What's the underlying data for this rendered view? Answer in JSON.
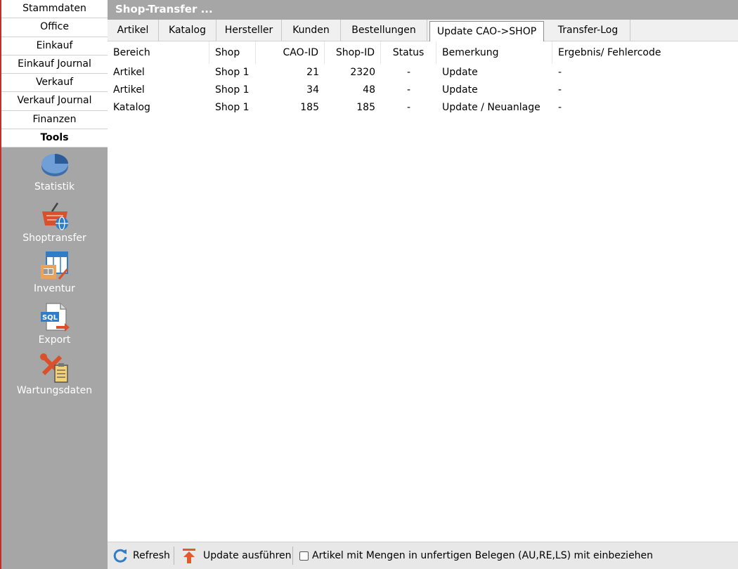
{
  "sidebar": {
    "nav_items": [
      {
        "label": "Stammdaten"
      },
      {
        "label": "Office"
      },
      {
        "label": "Einkauf"
      },
      {
        "label": "Einkauf Journal"
      },
      {
        "label": "Verkauf"
      },
      {
        "label": "Verkauf Journal"
      },
      {
        "label": "Finanzen"
      },
      {
        "label": "Tools"
      }
    ],
    "active_item": "Tools",
    "tools": [
      {
        "label": "Statistik",
        "icon": "pie-chart-icon"
      },
      {
        "label": "Shoptransfer",
        "icon": "shopping-basket-globe-icon"
      },
      {
        "label": "Inventur",
        "icon": "inventory-barcode-icon"
      },
      {
        "label": "Export",
        "icon": "sql-export-icon"
      },
      {
        "label": "Wartungsdaten",
        "icon": "tools-clipboard-icon"
      }
    ]
  },
  "window": {
    "title": "Shop-Transfer ..."
  },
  "tabs": [
    {
      "label": "Artikel"
    },
    {
      "label": "Katalog"
    },
    {
      "label": "Hersteller"
    },
    {
      "label": "Kunden"
    },
    {
      "label": "Bestellungen"
    },
    {
      "label": "Update CAO->SHOP"
    },
    {
      "label": "Transfer-Log"
    }
  ],
  "active_tab": "Update CAO->SHOP",
  "table": {
    "columns": [
      "Bereich",
      "Shop",
      "CAO-ID",
      "Shop-ID",
      "Status",
      "Bemerkung",
      "Ergebnis/ Fehlercode"
    ],
    "rows": [
      [
        "Artikel",
        "Shop 1",
        "21",
        "2320",
        "-",
        "Update",
        "-"
      ],
      [
        "Artikel",
        "Shop 1",
        "34",
        "48",
        "-",
        "Update",
        "-"
      ],
      [
        "Katalog",
        "Shop 1",
        "185",
        "185",
        "-",
        "Update / Neuanlage",
        "-"
      ]
    ]
  },
  "toolbar": {
    "refresh_label": "Refresh",
    "refresh_icon": "refresh-icon",
    "update_label": "Update ausführen",
    "update_icon": "arrow-up-icon",
    "checkbox_label": "Artikel mit Mengen in unfertigen Belegen (AU,RE,LS) mit einbeziehen",
    "checkbox_checked": false
  },
  "colors": {
    "sidebar_bg": "#a6a6a6",
    "sidebar_accent": "#c0302a",
    "title_bg": "#a6a6a6",
    "toolbar_icon_blue": "#2e7dc8",
    "toolbar_icon_orange": "#e05a2a"
  }
}
